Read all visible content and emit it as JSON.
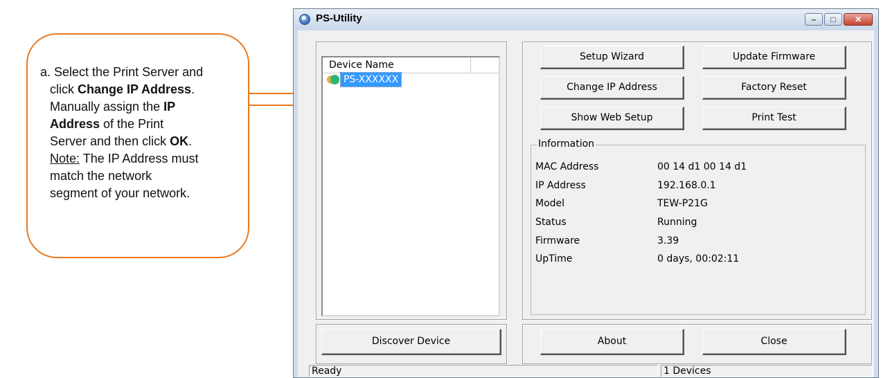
{
  "callout": {
    "marker": "a.",
    "line1": "Select the Print Server and",
    "line2_pre": "click ",
    "line2_bold": "Change IP Address",
    "line2_post": ".",
    "line3_pre": "Manually assign the ",
    "line3_bold": "IP",
    "line4_bold": "Address",
    "line4_post": " of the Print",
    "line5_pre": "Server and then click ",
    "line5_bold": "OK",
    "line5_post": ".",
    "line6_note": "Note:",
    "line6_post": " The IP Address must",
    "line7": "match the network",
    "line8": "segment of your network."
  },
  "window": {
    "title": "PS-Utility",
    "minimize_glyph": "–",
    "maximize_glyph": "□",
    "close_glyph": "✕"
  },
  "device_list": {
    "column_header": "Device Name",
    "devices": [
      {
        "name": "PS-XXXXXX"
      }
    ]
  },
  "buttons": {
    "setup_wizard": "Setup Wizard",
    "update_firmware": "Update Firmware",
    "change_ip": "Change IP Address",
    "factory_reset": "Factory Reset",
    "show_web_setup": "Show Web Setup",
    "print_test": "Print Test",
    "discover_device": "Discover Device",
    "about": "About",
    "close": "Close"
  },
  "information": {
    "legend": "Information",
    "rows": [
      {
        "label": "MAC Address",
        "value": "00 14 d1 00 14 d1"
      },
      {
        "label": "IP Address",
        "value": "192.168.0.1"
      },
      {
        "label": "Model",
        "value": "TEW-P21G"
      },
      {
        "label": "Status",
        "value": "Running"
      },
      {
        "label": "Firmware",
        "value": "3.39"
      },
      {
        "label": "UpTime",
        "value": "0 days, 00:02:11"
      }
    ]
  },
  "statusbar": {
    "status": "Ready",
    "device_count": "1 Devices"
  },
  "colors": {
    "callout_accent": "#e8781e",
    "selection": "#3399ff"
  },
  "icons": {
    "app": "ps-utility-globe-icon",
    "device": "print-server-device-icon"
  }
}
